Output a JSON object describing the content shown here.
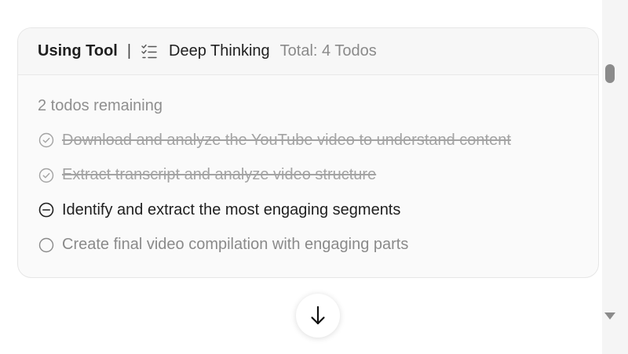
{
  "header": {
    "tool_label": "Using Tool",
    "separator": "|",
    "tool_icon": "checklist-icon",
    "tool_name": "Deep Thinking",
    "total": "Total: 4 Todos"
  },
  "body": {
    "remaining": "2 todos remaining",
    "todos": [
      {
        "text": "Download and analyze the YouTube video to understand content",
        "status": "completed",
        "icon": "check-circle-icon"
      },
      {
        "text": "Extract transcript and analyze video structure",
        "status": "completed",
        "icon": "check-circle-icon"
      },
      {
        "text": "Identify and extract the most engaging segments",
        "status": "in-progress",
        "icon": "minus-circle-icon"
      },
      {
        "text": "Create final video compilation with engaging parts",
        "status": "pending",
        "icon": "empty-circle-icon"
      }
    ]
  },
  "scroll_button": {
    "icon": "arrow-down-icon"
  },
  "colors": {
    "card_bg": "#fafafa",
    "header_bg": "#f7f7f7",
    "border": "#e6e6e6",
    "text_dark": "#1f1f1f",
    "text_muted": "#8a8a8a",
    "text_done": "#a3a3a3"
  }
}
